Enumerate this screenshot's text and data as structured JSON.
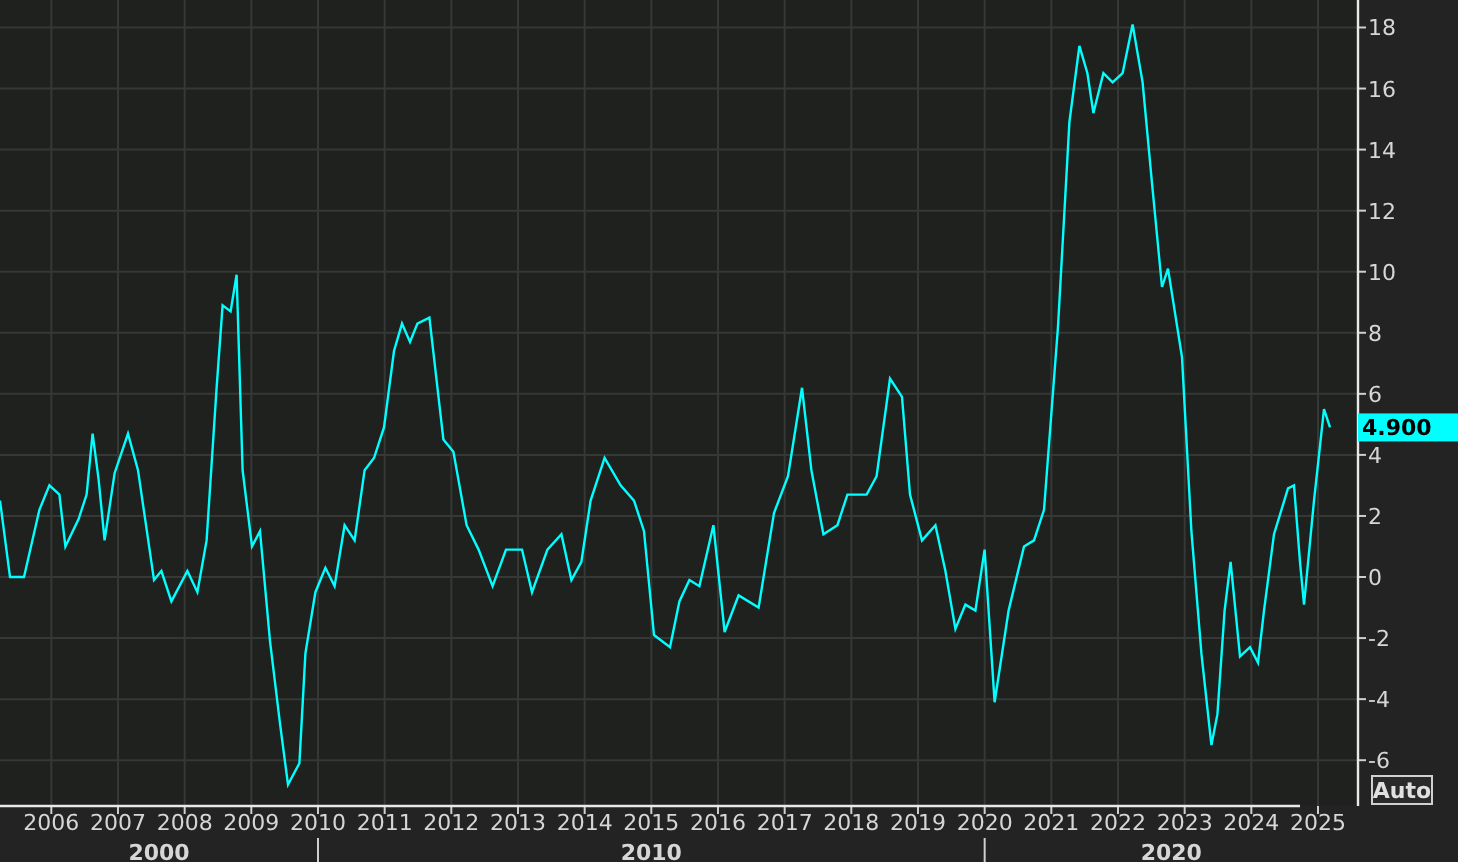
{
  "chart": {
    "chart_data": {
      "type": "line",
      "x": [
        2005.23,
        2005.38,
        2005.59,
        2005.82,
        2005.97,
        2006.12,
        2006.21,
        2006.41,
        2006.53,
        2006.62,
        2006.71,
        2006.8,
        2006.95,
        2007.15,
        2007.3,
        2007.54,
        2007.65,
        2007.8,
        2008.04,
        2008.19,
        2008.33,
        2008.48,
        2008.57,
        2008.69,
        2008.78,
        2008.87,
        2009.01,
        2009.13,
        2009.28,
        2009.43,
        2009.55,
        2009.72,
        2009.81,
        2009.96,
        2010.11,
        2010.25,
        2010.4,
        2010.55,
        2010.7,
        2010.84,
        2010.99,
        2011.14,
        2011.26,
        2011.38,
        2011.49,
        2011.67,
        2011.88,
        2012.03,
        2012.23,
        2012.41,
        2012.62,
        2012.82,
        2013.06,
        2013.21,
        2013.44,
        2013.65,
        2013.8,
        2013.95,
        2014.09,
        2014.3,
        2014.54,
        2014.74,
        2014.89,
        2015.04,
        2015.28,
        2015.42,
        2015.57,
        2015.72,
        2015.93,
        2016.1,
        2016.31,
        2016.61,
        2016.84,
        2017.05,
        2017.26,
        2017.4,
        2017.58,
        2017.79,
        2017.94,
        2018.23,
        2018.38,
        2018.58,
        2018.76,
        2018.88,
        2019.06,
        2019.26,
        2019.41,
        2019.56,
        2019.71,
        2019.86,
        2020.0,
        2020.15,
        2020.36,
        2020.59,
        2020.74,
        2020.89,
        2021.1,
        2021.27,
        2021.42,
        2021.54,
        2021.63,
        2021.78,
        2021.92,
        2022.07,
        2022.22,
        2022.37,
        2022.51,
        2022.66,
        2022.75,
        2022.96,
        2023.1,
        2023.25,
        2023.4,
        2023.49,
        2023.6,
        2023.69,
        2023.83,
        2023.98,
        2024.1,
        2024.19,
        2024.34,
        2024.55,
        2024.64,
        2024.73,
        2024.79,
        2024.94,
        2025.09,
        2025.18
      ],
      "series": [
        {
          "color": "#00ffff",
          "values": [
            2.5,
            0,
            0,
            2.2,
            3,
            2.7,
            1,
            1.9,
            2.7,
            4.7,
            3.2,
            1.2,
            3.4,
            4.7,
            3.5,
            -0.1,
            0.2,
            -0.8,
            0.2,
            -0.5,
            1.2,
            6.2,
            8.9,
            8.7,
            9.9,
            3.5,
            1,
            1.5,
            -2.1,
            -4.8,
            -6.8,
            -6.1,
            -2.5,
            -0.5,
            0.3,
            -0.3,
            1.7,
            1.2,
            3.5,
            3.9,
            4.9,
            7.4,
            8.3,
            7.7,
            8.3,
            8.5,
            4.5,
            4.1,
            1.7,
            0.9,
            -0.3,
            0.9,
            0.9,
            -0.5,
            0.9,
            1.4,
            -0.1,
            0.5,
            2.5,
            3.9,
            3,
            2.5,
            1.5,
            -1.9,
            -2.3,
            -0.8,
            -0.1,
            -0.3,
            1.7,
            -1.8,
            -0.6,
            -1,
            2.1,
            3.3,
            6.2,
            3.5,
            1.4,
            1.7,
            2.7,
            2.7,
            3.3,
            6.5,
            5.9,
            2.7,
            1.2,
            1.7,
            0.2,
            -1.7,
            -0.9,
            -1.1,
            0.9,
            -4.1,
            -1.1,
            1,
            1.2,
            2.2,
            8.2,
            14.9,
            17.4,
            16.5,
            15.2,
            16.5,
            16.2,
            16.5,
            18.1,
            16.2,
            12.9,
            9.5,
            10.1,
            7.2,
            1.5,
            -2.5,
            -5.5,
            -4.5,
            -1.1,
            0.5,
            -2.6,
            -2.3,
            -2.8,
            -1.1,
            1.4,
            2.9,
            3,
            0.5,
            -0.9,
            2.5,
            5.5,
            4.9
          ]
        }
      ],
      "xlim": [
        2005.23,
        2025.6
      ],
      "ylim": [
        -7.5,
        18.9
      ],
      "xticks": [
        2006,
        2007,
        2008,
        2009,
        2010,
        2011,
        2012,
        2013,
        2014,
        2015,
        2016,
        2017,
        2018,
        2019,
        2020,
        2021,
        2022,
        2023,
        2024,
        2025
      ],
      "yticks": [
        -6,
        -4,
        -2,
        0,
        2,
        4,
        6,
        8,
        10,
        12,
        14,
        16,
        18
      ],
      "grid": true
    },
    "decades": [
      {
        "label": "2000"
      },
      {
        "label": "2010"
      },
      {
        "label": "2020"
      }
    ],
    "last_value": {
      "label": "4.900"
    },
    "scale_button": "Auto"
  }
}
